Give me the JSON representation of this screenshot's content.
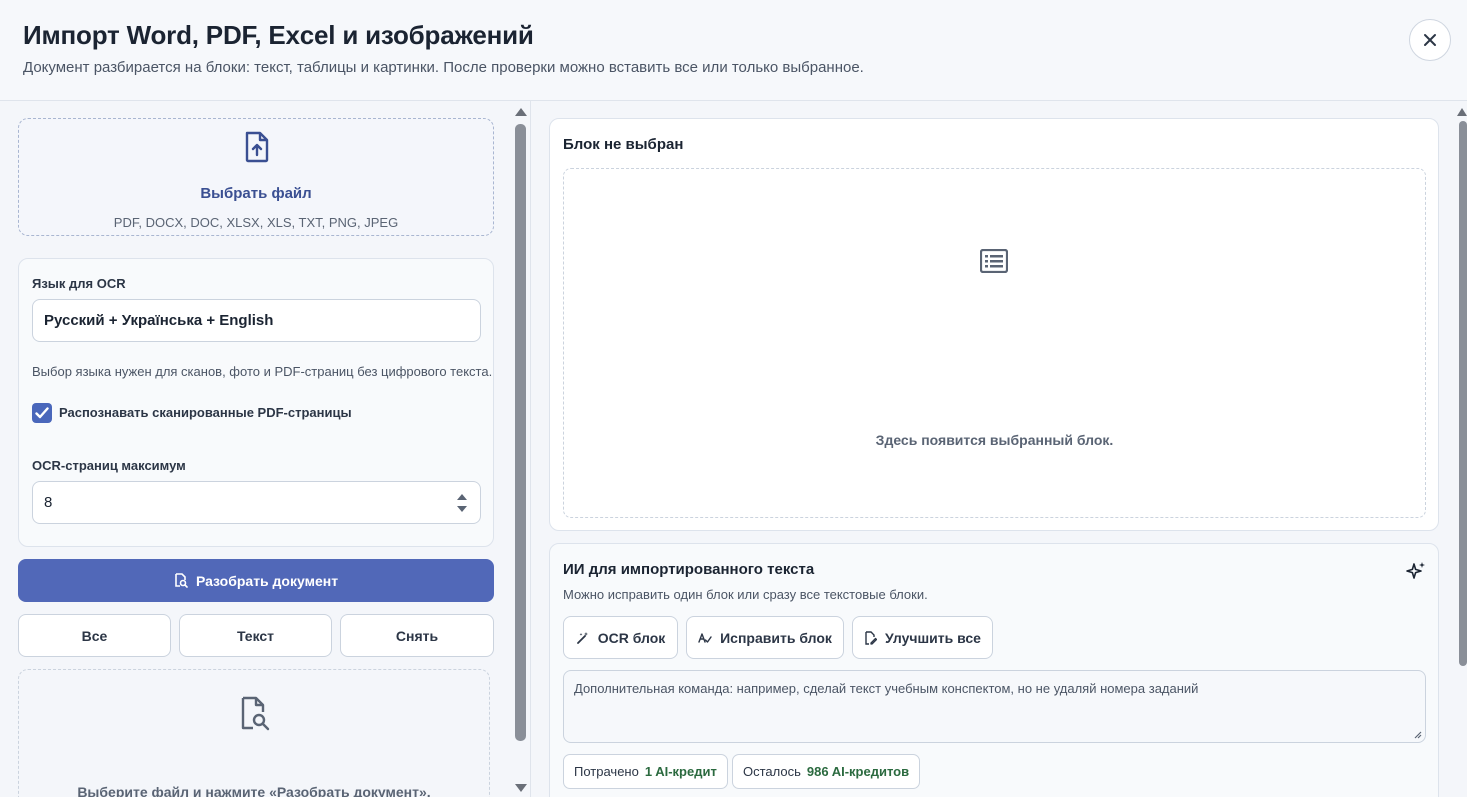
{
  "header": {
    "title": "Импорт Word, PDF, Excel и изображений",
    "subtitle": "Документ разбирается на блоки: текст, таблицы и картинки. После проверки можно вставить все или только выбранное.",
    "close_icon": "close-icon"
  },
  "upload": {
    "icon": "file-upload-icon",
    "choose_label": "Выбрать файл",
    "formats": "PDF, DOCX, DOC, XLSX, XLS, TXT, PNG, JPEG"
  },
  "ocr": {
    "language_label": "Язык для OCR",
    "language_value": "Русский + Українська + English",
    "hint": "Выбор языка нужен для сканов, фото и PDF-страниц без цифрового текста.",
    "scan_checkbox_label": "Распознавать сканированные PDF-страницы",
    "scan_checked": true,
    "max_pages_label": "OCR-страниц максимум",
    "max_pages_value": "8"
  },
  "actions": {
    "parse_label": "Разобрать документ",
    "parse_icon": "file-search-icon",
    "filter_all": "Все",
    "filter_text": "Текст",
    "filter_clear": "Снять"
  },
  "blocks": {
    "empty_icon": "file-search-icon",
    "empty_message": "Выберите файл и нажмите «Разобрать документ»."
  },
  "preview": {
    "title": "Блок не выбран",
    "icon": "list-icon",
    "message": "Здесь появится выбранный блок."
  },
  "ai": {
    "title": "ИИ для импортированного текста",
    "subtitle": "Можно исправить один блок или сразу все текстовые блоки.",
    "sparkle_icon": "sparkle-icon",
    "ocr_block_label": "OCR блок",
    "fix_block_label": "Исправить блок",
    "improve_all_label": "Улучшить все",
    "command_placeholder": "Дополнительная команда: например, сделай текст учебным конспектом, но не удаляй номера заданий",
    "spent_label": "Потрачено",
    "spent_value": "1 AI-кредит",
    "left_label": "Осталось",
    "left_value": "986 AI-кредитов"
  },
  "colors": {
    "accent": "#5168b8",
    "credit_green": "#2b6a3f"
  }
}
